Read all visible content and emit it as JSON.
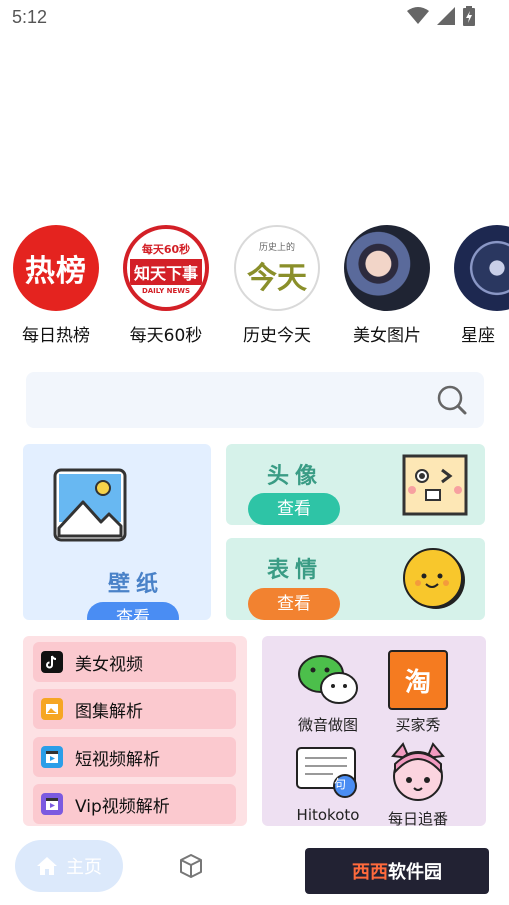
{
  "status_bar": {
    "time": "5:12"
  },
  "shortcuts": [
    {
      "label": "每日热榜",
      "badge_text": "热榜"
    },
    {
      "label": "每天60秒",
      "badge_top": "每天60秒",
      "badge_mid": "知天下事",
      "badge_bottom": "DAILY NEWS"
    },
    {
      "label": "历史今天",
      "badge_top": "历史上的",
      "badge_mid": "今天"
    },
    {
      "label": "美女图片"
    },
    {
      "label": "星座"
    }
  ],
  "search": {
    "placeholder": "",
    "value": ""
  },
  "cards": {
    "wallpaper": {
      "title": "壁纸",
      "button": "查看"
    },
    "avatar": {
      "title": "头像",
      "button": "查看"
    },
    "emoji": {
      "title": "表情",
      "button": "查看"
    }
  },
  "videos": [
    {
      "label": "美女视频",
      "icon": "tiktok-icon"
    },
    {
      "label": "图集解析",
      "icon": "image-icon"
    },
    {
      "label": "短视频解析",
      "icon": "clapper-icon"
    },
    {
      "label": "Vip视频解析",
      "icon": "clapper-icon"
    }
  ],
  "apps": [
    {
      "label": "微音做图",
      "icon": "wechat-icon"
    },
    {
      "label": "买家秀",
      "icon": "taobao-icon",
      "icon_text": "淘"
    },
    {
      "label": "Hitokoto",
      "icon": "quote-icon",
      "icon_text": "句"
    },
    {
      "label": "每日追番",
      "icon": "anime-icon"
    }
  ],
  "bottom_nav": {
    "home": "主页"
  },
  "watermark": {
    "part1": "西西",
    "part2": "软件园"
  },
  "colors": {
    "btn_green": "#2ec4a6",
    "btn_orange": "#f28230",
    "wallpaper_btn": "#4a8df3",
    "wallpaper_title": "#4a82c8",
    "card_title_green": "#3a9c85"
  }
}
